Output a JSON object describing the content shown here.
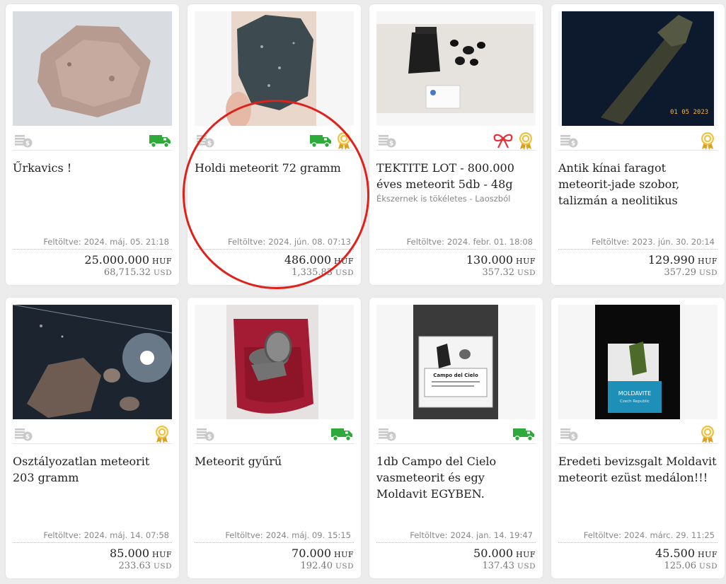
{
  "listings": [
    {
      "title": "Űrkavics !",
      "subtitle": "",
      "uploaded_label": "Feltöltve:",
      "uploaded_date": "2024. máj. 05. 21:18",
      "price": "25.000.000",
      "price_currency": "HUF",
      "usd": "68,715.32",
      "usd_currency": "USD",
      "icons": [
        "currency-icon",
        "delivery-truck-icon"
      ]
    },
    {
      "title": "Holdi meteorit 72 gramm",
      "subtitle": "",
      "uploaded_label": "Feltöltve:",
      "uploaded_date": "2024. jún. 08. 07:13",
      "price": "486.000",
      "price_currency": "HUF",
      "usd": "1,335.83",
      "usd_currency": "USD",
      "icons": [
        "currency-icon",
        "delivery-truck-icon",
        "award-badge-icon"
      ]
    },
    {
      "title": "TEKTITE LOT - 800.000 éves meteorit 5db - 48g",
      "subtitle": "Ékszernek is tökéletes - Laoszból",
      "uploaded_label": "Feltöltve:",
      "uploaded_date": "2024. febr. 01. 18:08",
      "price": "130.000",
      "price_currency": "HUF",
      "usd": "357.32",
      "usd_currency": "USD",
      "icons": [
        "currency-icon",
        "gift-bow-icon",
        "award-badge-icon"
      ]
    },
    {
      "title": "Antik kínai faragot meteorit-jade szobor, talizmán a neolitikus",
      "subtitle": "",
      "uploaded_label": "Feltöltve:",
      "uploaded_date": "2023. jún. 30. 20:14",
      "price": "129.990",
      "price_currency": "HUF",
      "usd": "357.29",
      "usd_currency": "USD",
      "photo_stamp": "01 05 2023",
      "icons": [
        "currency-icon",
        "award-badge-icon"
      ]
    },
    {
      "title": "Osztályozatlan meteorit 203 gramm",
      "subtitle": "",
      "uploaded_label": "Feltöltve:",
      "uploaded_date": "2024. máj. 14. 07:58",
      "price": "85.000",
      "price_currency": "HUF",
      "usd": "233.63",
      "usd_currency": "USD",
      "icons": [
        "currency-icon",
        "award-badge-icon"
      ]
    },
    {
      "title": "Meteorit gyűrű",
      "subtitle": "",
      "uploaded_label": "Feltöltve:",
      "uploaded_date": "2024. máj. 09. 15:15",
      "price": "70.000",
      "price_currency": "HUF",
      "usd": "192.40",
      "usd_currency": "USD",
      "icons": [
        "currency-icon",
        "delivery-truck-icon"
      ]
    },
    {
      "title": "1db Campo del Cielo vasmeteorit és egy Moldavit EGYBEN.",
      "subtitle": "",
      "uploaded_label": "Feltöltve:",
      "uploaded_date": "2024. jan. 14. 19:47",
      "price": "50.000",
      "price_currency": "HUF",
      "usd": "137.43",
      "usd_currency": "USD",
      "photo_label": "Campo del Cielo",
      "icons": [
        "currency-icon",
        "delivery-truck-icon"
      ]
    },
    {
      "title": "Eredeti bevizsgalt Moldavit meteorit ezüst medálon!!!",
      "subtitle": "",
      "uploaded_label": "Feltöltve:",
      "uploaded_date": "2024. márc. 29. 11:25",
      "price": "45.500",
      "price_currency": "HUF",
      "usd": "125.06",
      "usd_currency": "USD",
      "photo_label": "MOLDAVITE",
      "photo_sublabel": "Czech Republic",
      "icons": [
        "currency-icon",
        "award-badge-icon"
      ]
    }
  ],
  "colors": {
    "truck": "#2eaa3a",
    "badge": "#e8b530",
    "bow": "#e2323c",
    "highlight_circle": "#e0211b"
  }
}
